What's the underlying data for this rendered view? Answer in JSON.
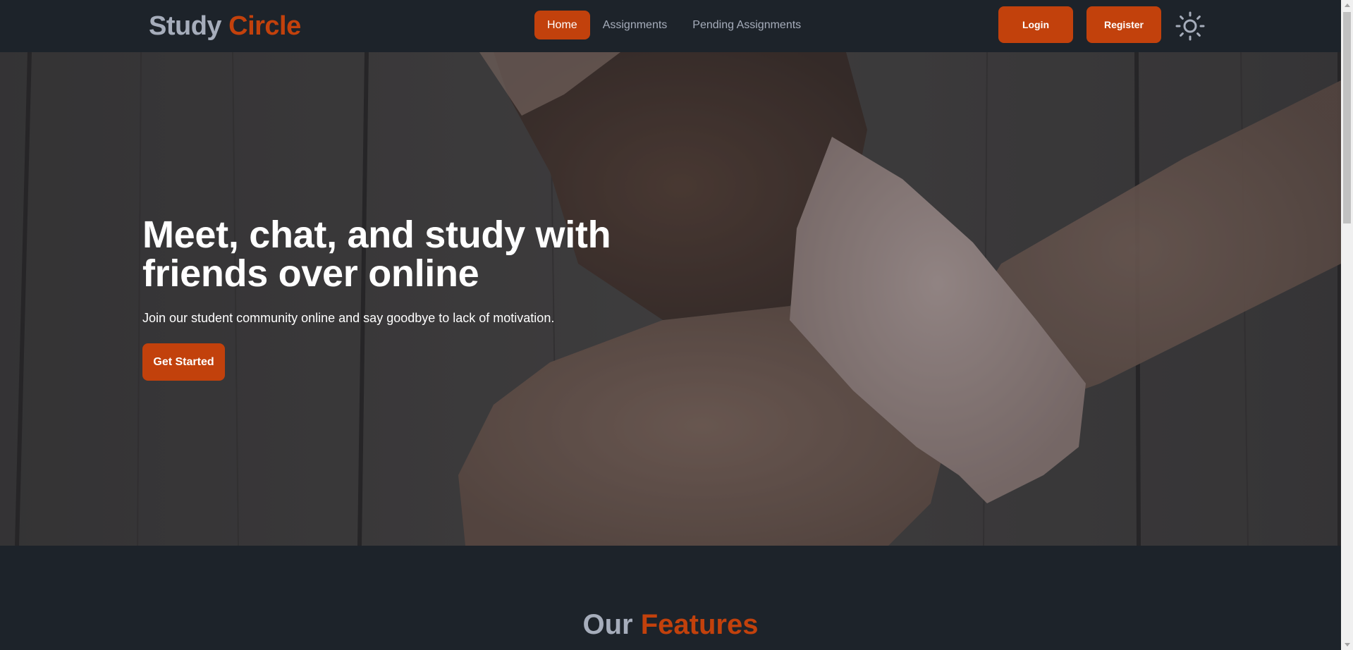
{
  "navbar": {
    "brand": {
      "part1": "Study",
      "part2": "Circle"
    },
    "links": [
      {
        "label": "Home",
        "active": true
      },
      {
        "label": "Assignments",
        "active": false
      },
      {
        "label": "Pending Assignments",
        "active": false
      }
    ],
    "login_label": "Login",
    "register_label": "Register",
    "theme_icon": "sun-icon"
  },
  "hero": {
    "title": "Meet, chat, and study with friends over online",
    "subtitle": "Join our student community online and say goodbye to lack of motivation.",
    "cta_label": "Get Started",
    "background_image": "hands-holding-wrists-on-wooden-table"
  },
  "features": {
    "title_part1": "Our",
    "title_part2": "Features"
  },
  "colors": {
    "background": "#1d232a",
    "accent": "#c2410c",
    "muted_text": "#a6adbb",
    "text_light": "#ffffff"
  }
}
